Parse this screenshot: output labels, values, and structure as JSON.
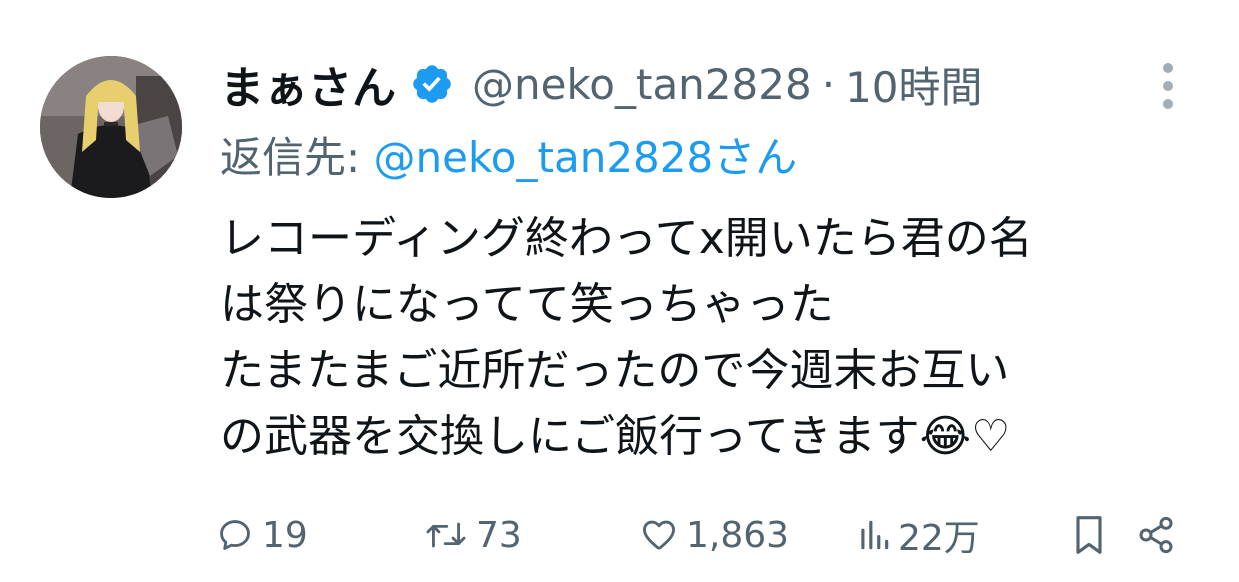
{
  "tweet": {
    "display_name": "まぁさん",
    "handle": "@neko_tan2828",
    "separator": "·",
    "time": "10時間",
    "reply_label": "返信先: ",
    "reply_target": "@neko_tan2828さん",
    "body_lines": [
      "レコーディング終わってx開いたら君の名",
      "は祭りになってて笑っちゃった",
      "たまたまご近所だったので今週末お互い",
      "の武器を交換しにご飯行ってきます😂♡"
    ],
    "actions": {
      "replies": "19",
      "reposts": "73",
      "likes": "1,863",
      "views": "22万"
    }
  },
  "icons": [
    "verified-badge-icon",
    "more-icon",
    "reply-icon",
    "repost-icon",
    "like-icon",
    "views-icon",
    "bookmark-icon",
    "share-icon"
  ],
  "colors": {
    "text_primary": "#0f1419",
    "text_secondary": "#536471",
    "accent": "#1d9bf0"
  }
}
